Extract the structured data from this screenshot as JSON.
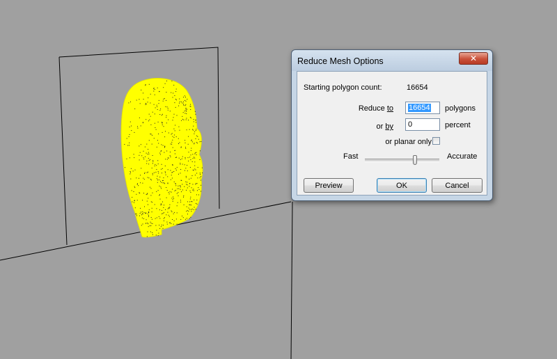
{
  "viewport": {
    "background_color": "#a0a0a0",
    "mesh_color": "#ffff00",
    "mesh_dot_color": "#222222"
  },
  "dialog": {
    "title": "Reduce Mesh Options",
    "close_icon": "close-icon",
    "close_glyph": "✕",
    "starting_label": "Starting polygon count:",
    "starting_value": "16654",
    "reduce_to_label_prefix": "Reduce ",
    "reduce_to_label_key": "to",
    "reduce_to_value": "16654",
    "reduce_to_unit": "polygons",
    "or_by_label_prefix": "or ",
    "or_by_label_key": "by",
    "or_by_value": "0",
    "or_by_unit": "percent",
    "planar_only_label": "or planar only",
    "planar_only_checked": false,
    "slider_left_label": "Fast",
    "slider_right_label": "Accurate",
    "slider_value": 0.67,
    "preview_button": "Preview",
    "ok_button": "OK",
    "cancel_button": "Cancel",
    "accent_color": "#3399ff"
  }
}
